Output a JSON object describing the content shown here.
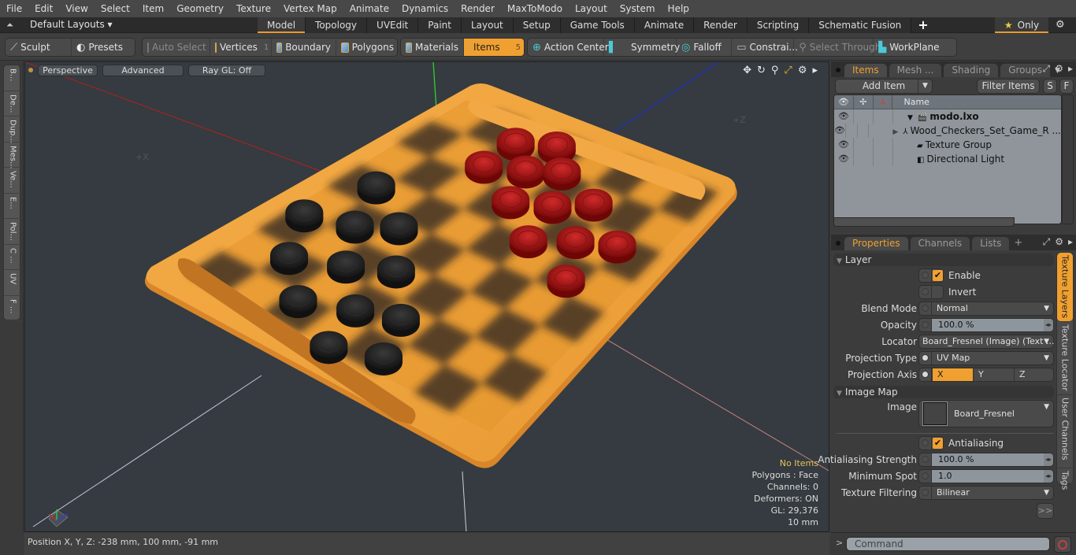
{
  "menubar": {
    "items": [
      "File",
      "Edit",
      "View",
      "Select",
      "Item",
      "Geometry",
      "Texture",
      "Vertex Map",
      "Animate",
      "Dynamics",
      "Render",
      "MaxToModo",
      "Layout",
      "System",
      "Help"
    ]
  },
  "layoutbar": {
    "layouts_label": "Default Layouts ▾",
    "tabs": [
      "Model",
      "Topology",
      "UVEdit",
      "Paint",
      "Layout",
      "Setup",
      "Game Tools",
      "Animate",
      "Render",
      "Scripting",
      "Schematic Fusion"
    ],
    "active_tab": "Model",
    "add_tab": "+",
    "only_label": "Only",
    "star": "★",
    "gear": "⚙"
  },
  "toolbar": {
    "sculpt": "Sculpt",
    "presets": "Presets",
    "auto_select": "Auto Select",
    "vertices": "Vertices",
    "vertices_count": "1",
    "boundary": "Boundary",
    "polygons": "Polygons",
    "materials": "Materials",
    "items": "Items",
    "items_count": "5",
    "action_center": "Action Center",
    "symmetry": "Symmetry",
    "falloff": "Falloff",
    "constraints": "Constrai...",
    "select_through": "Select Through",
    "workplane": "WorkPlane"
  },
  "left_tabs": [
    "B...",
    "De...",
    "Dup...",
    "Mes...",
    "Ve...",
    "E...",
    "Pol...",
    "C ...",
    "UV",
    "F ..."
  ],
  "viewport": {
    "view_mode": "Perspective",
    "shading": "Advanced",
    "raygl": "Ray GL: Off",
    "axis_labels": {
      "x": "+X",
      "z": "+Z"
    },
    "info": {
      "selection": "No Items",
      "polygons": "Polygons : Face",
      "channels": "Channels: 0",
      "deformers": "Deformers: ON",
      "gl": "GL: 29,376",
      "unit": "10 mm"
    },
    "colors": {
      "board": "#f0a540",
      "red_piece": "#b01818",
      "black_piece": "#1e1e1e",
      "bg": "#353b40"
    },
    "board": {
      "red_pieces": 12,
      "black_pieces": 12
    }
  },
  "statusbar": {
    "position": "Position X, Y, Z:   -238 mm, 100 mm, -91 mm"
  },
  "items_panel": {
    "tabs": [
      "Items",
      "Mesh ...",
      "Shading",
      "Groups"
    ],
    "active_tab": "Items",
    "add_item": "Add Item",
    "filter_items": "Filter Items",
    "s_btn": "S",
    "f_btn": "F",
    "name_col": "Name",
    "tree": [
      {
        "name": "modo.lxo",
        "bold": true
      },
      {
        "name": "Wood_Checkers_Set_Game_R ..."
      },
      {
        "name": "Texture Group"
      },
      {
        "name": "Directional Light"
      }
    ]
  },
  "properties_panel": {
    "tabs": [
      "Properties",
      "Channels",
      "Lists"
    ],
    "active_tab": "Properties",
    "add": "+",
    "layer_section": "Layer",
    "enable": {
      "label": "Enable",
      "checked": true
    },
    "invert": {
      "label": "Invert",
      "checked": false
    },
    "blend_mode": {
      "label": "Blend Mode",
      "value": "Normal"
    },
    "opacity": {
      "label": "Opacity",
      "value": "100.0 %"
    },
    "locator": {
      "label": "Locator",
      "value": "Board_Fresnel (Image) (Text ..."
    },
    "projection_type": {
      "label": "Projection Type",
      "value": "UV Map"
    },
    "projection_axis": {
      "label": "Projection Axis",
      "options": [
        "X",
        "Y",
        "Z"
      ],
      "selected": "X"
    },
    "image_map_section": "Image Map",
    "image": {
      "label": "Image",
      "value": "Board_Fresnel"
    },
    "antialiasing": {
      "label": "Antialiasing",
      "checked": true
    },
    "aa_strength": {
      "label": "Antialiasing Strength",
      "value": "100.0 %"
    },
    "min_spot": {
      "label": "Minimum Spot",
      "value": "1.0"
    },
    "tex_filter": {
      "label": "Texture Filtering",
      "value": "Bilinear"
    },
    "more": ">>",
    "side_tabs": [
      "Texture Layers",
      "Texture Locator",
      "User Channels",
      "Tags"
    ],
    "active_side_tab": "Texture Layers"
  },
  "command": {
    "prompt": ">",
    "placeholder": "Command"
  },
  "accent": "#f0a030"
}
